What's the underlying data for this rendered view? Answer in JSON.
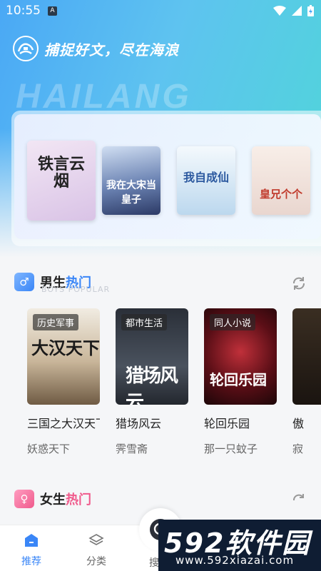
{
  "status_bar": {
    "time": "10:55",
    "indicator": "A"
  },
  "header": {
    "slogan": "捕捉好文，尽在海浪",
    "watermark": "HAILANG"
  },
  "banner": {
    "covers": [
      {
        "title": "铁言云烟",
        "bg": "#e8d8ef"
      },
      {
        "title": "我在大宋当皇子",
        "bg": "#3b5080"
      },
      {
        "title": "我自成仙",
        "bg": "#cfe4f3"
      },
      {
        "title": "皇兄个个",
        "bg": "#f3e6e0"
      }
    ]
  },
  "boys_section": {
    "title_plain": "男生",
    "title_accent": "热门",
    "subtitle": "BOYS POPULAR",
    "books": [
      {
        "tag": "历史军事",
        "title": "三国之大汉天下",
        "author": "妖惑天下",
        "cover_text": "大汉天下"
      },
      {
        "tag": "都市生活",
        "title": "猎场风云",
        "author": "霁雪斋",
        "cover_text": "猎场风云"
      },
      {
        "tag": "同人小说",
        "title": "轮回乐园",
        "author": "那一只蚊子",
        "cover_text": "轮回乐园"
      },
      {
        "tag": "",
        "title": "傲",
        "author": "寂",
        "cover_text": ""
      }
    ]
  },
  "girls_section": {
    "title_plain": "女生",
    "title_accent": "热门"
  },
  "bottom_nav": {
    "recommend": "推荐",
    "category": "分类",
    "search": "搜"
  },
  "site_badge": {
    "big": "592软件园",
    "url": "www.592xiazai.com"
  },
  "colors": {
    "accent": "#3a86f7",
    "pink": "#f05a8c"
  }
}
